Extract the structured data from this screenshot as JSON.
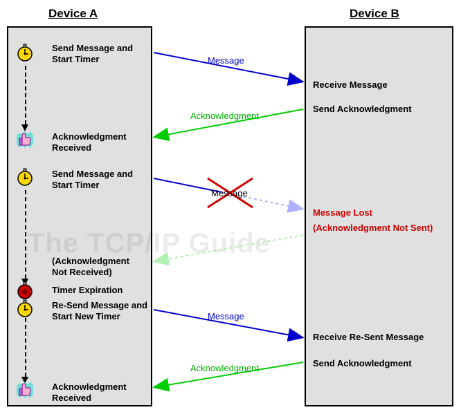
{
  "headers": {
    "deviceA": "Device A",
    "deviceB": "Device B"
  },
  "watermark": "The TCP/IP Guide",
  "stepsA": {
    "s1": "Send Message and Start Timer",
    "s2": "Acknowledgment Received",
    "s3": "Send Message and Start Timer",
    "s4": "(Acknowledgment Not Received)",
    "s5": "Timer Expiration",
    "s6": "Re-Send Message and Start New Timer",
    "s7": "Acknowledgment Received"
  },
  "stepsB": {
    "s1": "Receive Message",
    "s2": "Send Acknowledgment",
    "s3a": "Message Lost",
    "s3b": "(Acknowledgment Not Sent)",
    "s4": "Receive Re-Sent Message",
    "s5": "Send Acknowledgment"
  },
  "arrows": {
    "msg1": "Message",
    "ack1": "Acknowledgment",
    "msg2": "Message",
    "msg3": "Message",
    "ack3": "Acknowledgment"
  }
}
